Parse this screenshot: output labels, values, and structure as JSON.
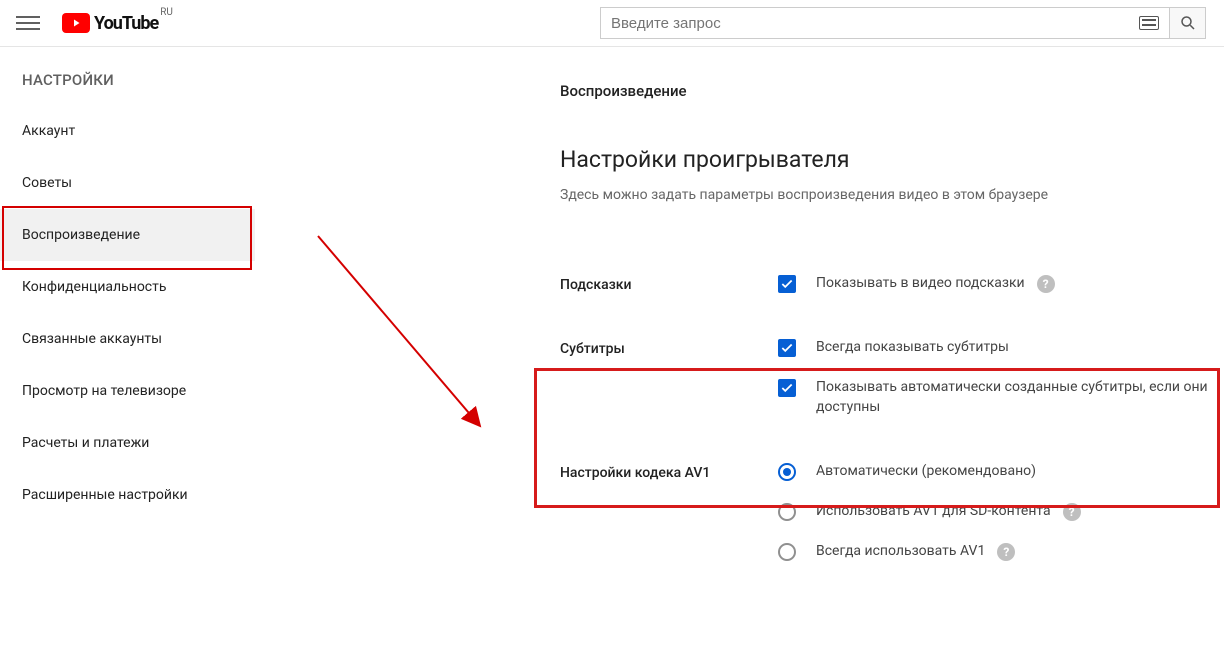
{
  "header": {
    "region": "RU",
    "logo_text": "YouTube",
    "search_placeholder": "Введите запрос"
  },
  "sidebar": {
    "title": "НАСТРОЙКИ",
    "items": [
      {
        "label": "Аккаунт"
      },
      {
        "label": "Советы"
      },
      {
        "label": "Воспроизведение",
        "active": true
      },
      {
        "label": "Конфиденциальность"
      },
      {
        "label": "Связанные аккаунты"
      },
      {
        "label": "Просмотр на телевизоре"
      },
      {
        "label": "Расчеты и платежи"
      },
      {
        "label": "Расширенные настройки"
      }
    ]
  },
  "main": {
    "breadcrumb": "Воспроизведение",
    "title": "Настройки проигрывателя",
    "subtitle": "Здесь можно задать параметры воспроизведения видео в этом браузере",
    "hints_label": "Подсказки",
    "hints_option": "Показывать в видео подсказки",
    "subs_label": "Субтитры",
    "subs_opt1": "Всегда показывать субтитры",
    "subs_opt2": "Показывать автоматически созданные субтитры, если они доступны",
    "av1_label": "Настройки кодека AV1",
    "av1_opt1": "Автоматически (рекомендовано)",
    "av1_opt2": "Использовать AV1 для SD-контента",
    "av1_opt3": "Всегда использовать AV1"
  },
  "annotations": {
    "arrow_from": "sidebar-item-playback",
    "arrow_to": "subtitles-section",
    "highlight_boxes": [
      "sidebar-item-playback",
      "subtitles-section"
    ]
  }
}
